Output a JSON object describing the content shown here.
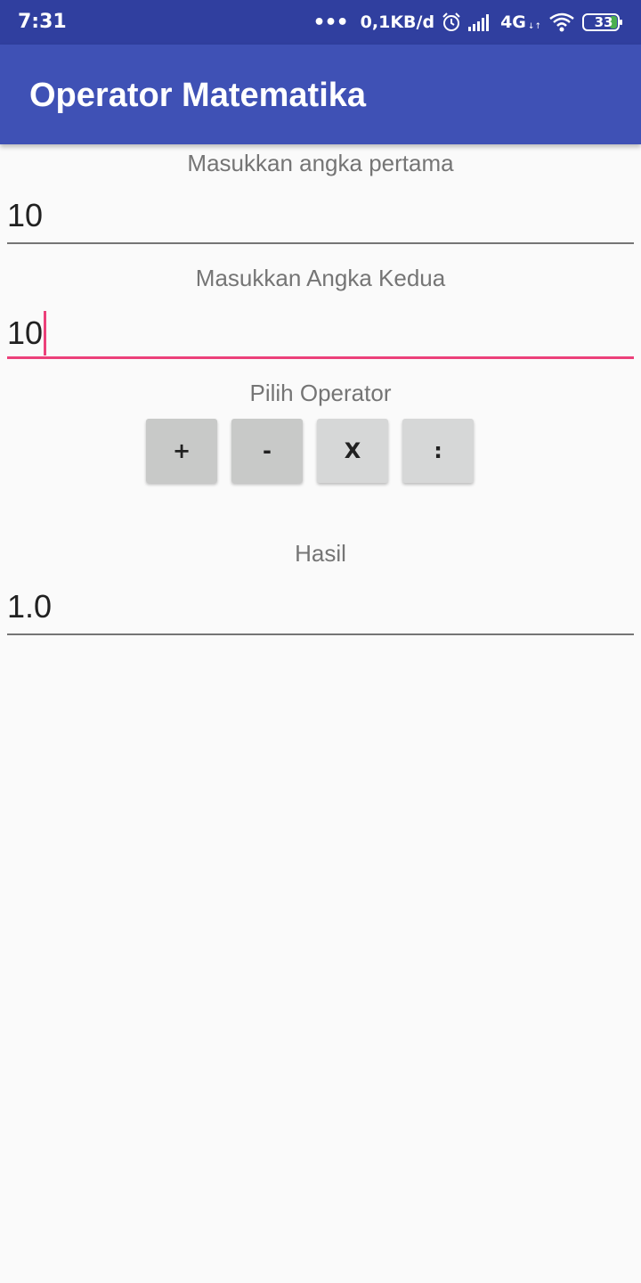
{
  "status_bar": {
    "time": "7:31",
    "dots": "•••",
    "data_rate": "0,1KB/d",
    "network_type": "4G",
    "network_sub": "↓↑",
    "battery_level": "33",
    "icons": [
      "alarm-icon",
      "signal-icon",
      "wifi-icon",
      "battery-icon"
    ]
  },
  "app_bar": {
    "title": "Operator Matematika",
    "color": "#3f51b5"
  },
  "form": {
    "first_label": "Masukkan angka pertama",
    "first_value": "10",
    "second_label": "Masukkan Angka Kedua",
    "second_value": "10",
    "operator_label": "Pilih Operator",
    "operators": {
      "add": "+",
      "subtract": "-",
      "multiply": "X",
      "divide": ":"
    },
    "result_label": "Hasil",
    "result_value": "1.0"
  },
  "colors": {
    "status_bar": "#303f9f",
    "accent": "#ec407a",
    "background": "#fafafa"
  }
}
